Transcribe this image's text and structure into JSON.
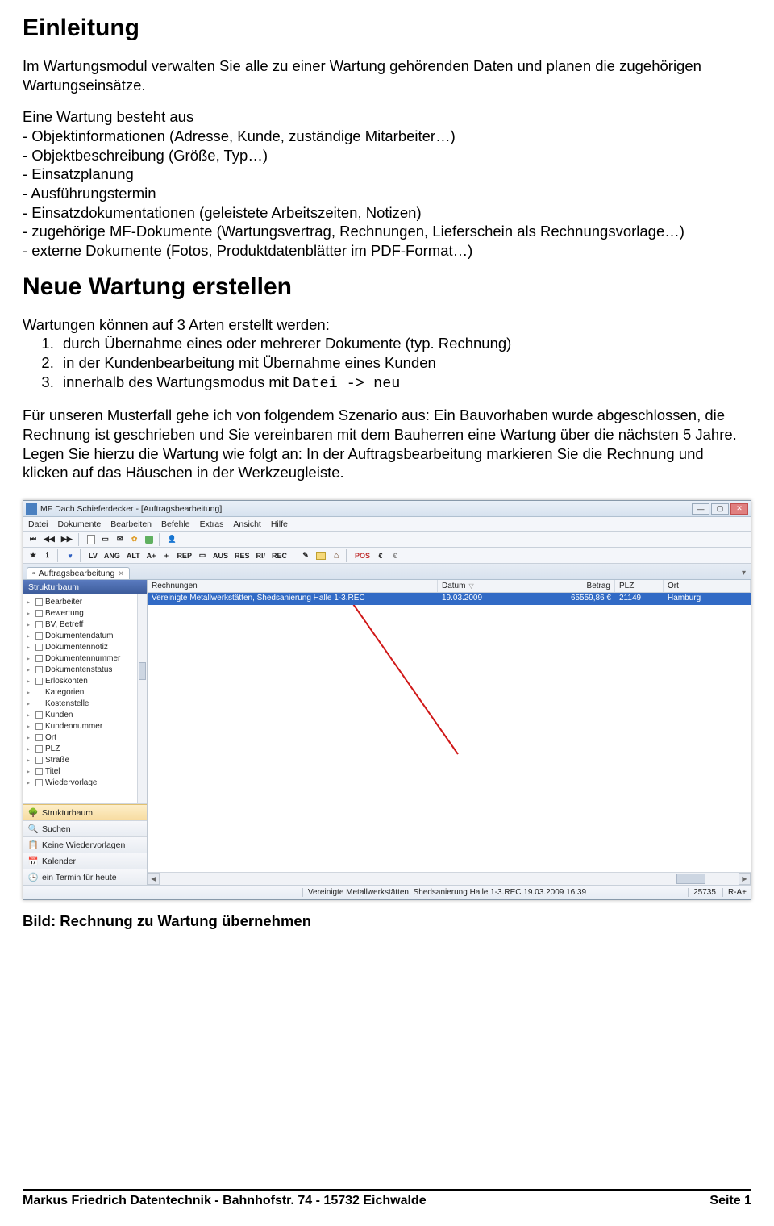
{
  "doc": {
    "h1": "Einleitung",
    "intro": "Im Wartungsmodul verwalten Sie alle zu einer Wartung gehörenden Daten und planen die zugehörigen Wartungseinsätze.",
    "p2_lead": "Eine Wartung besteht aus",
    "bullets": [
      "- Objektinformationen (Adresse, Kunde, zuständige Mitarbeiter…)",
      "- Objektbeschreibung (Größe, Typ…)",
      "- Einsatzplanung",
      "- Ausführungstermin",
      "- Einsatzdokumentationen (geleistete Arbeitszeiten, Notizen)",
      "- zugehörige MF-Dokumente (Wartungsvertrag, Rechnungen, Lieferschein als Rechnungsvorlage…)",
      "- externe Dokumente (Fotos, Produktdatenblätter im PDF-Format…)"
    ],
    "h2": "Neue Wartung erstellen",
    "p3": "Wartungen können auf 3 Arten erstellt werden:",
    "ol": [
      "durch Übernahme eines oder mehrerer Dokumente (typ. Rechnung)",
      "in der Kundenbearbeitung mit Übernahme eines Kunden",
      "innerhalb des Wartungsmodus mit "
    ],
    "ol3_mono": "Datei -> neu",
    "p4": "Für unseren Musterfall gehe ich von folgendem Szenario aus: Ein Bauvorhaben wurde abgeschlossen, die Rechnung ist geschrieben und Sie vereinbaren mit dem Bauherren eine Wartung über die nächsten 5 Jahre. Legen Sie hierzu die Wartung wie folgt an: In der Auftragsbearbeitung markieren Sie die Rechnung und klicken auf das Häuschen in der Werkzeugleiste.",
    "caption": "Bild: Rechnung zu Wartung übernehmen"
  },
  "app": {
    "title": "MF Dach Schieferdecker - [Auftragsbearbeitung]",
    "menu": [
      "Datei",
      "Dokumente",
      "Bearbeiten",
      "Befehle",
      "Extras",
      "Ansicht",
      "Hilfe"
    ],
    "tb2_text": [
      "LV",
      "ANG",
      "ALT",
      "A+",
      "+",
      "REP",
      "▭",
      "AUS",
      "RES",
      "RI/",
      "REC"
    ],
    "tab": {
      "label": "Auftragsbearbeitung"
    },
    "sidebar": {
      "header": "Strukturbaum",
      "tree": [
        "Bearbeiter",
        "Bewertung",
        "BV, Betreff",
        "Dokumentendatum",
        "Dokumentennotiz",
        "Dokumentennummer",
        "Dokumentenstatus",
        "Erlöskonten",
        "Kategorien",
        "Kostenstelle",
        "Kunden",
        "Kundennummer",
        "Ort",
        "PLZ",
        "Straße",
        "Titel",
        "Wiedervorlage"
      ],
      "panels": [
        "Strukturbaum",
        "Suchen",
        "Keine Wiedervorlagen",
        "Kalender",
        "ein Termin für heute"
      ]
    },
    "grid": {
      "cols": [
        "Rechnungen",
        "Datum",
        "Betrag",
        "PLZ",
        "Ort"
      ],
      "row": {
        "name": "Vereinigte Metallwerkstätten, Shedsanierung Halle 1-3.REC",
        "datum": "19.03.2009",
        "betrag": "65559,86 €",
        "plz": "21149",
        "ort": "Hamburg"
      }
    },
    "status": {
      "left": "Vereinigte Metallwerkstätten, Shedsanierung Halle 1-3.REC 19.03.2009 16:39",
      "num": "25735",
      "mode": "R-A+"
    }
  },
  "footer": {
    "left": "Markus Friedrich Datentechnik - Bahnhofstr. 74 - 15732 Eichwalde",
    "right": "Seite 1"
  }
}
